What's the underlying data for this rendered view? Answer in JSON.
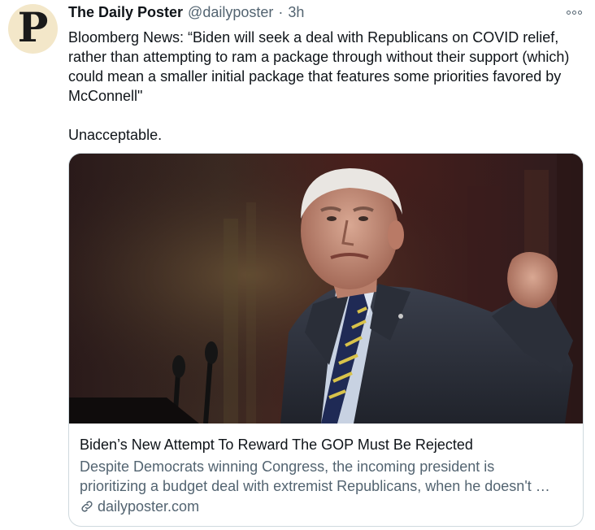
{
  "tweet": {
    "display_name": "The Daily Poster",
    "handle": "@dailyposter",
    "separator": "·",
    "time": "3h",
    "avatar_icon": "gothic-letter-P-logo",
    "avatar_glyph": "P",
    "more_icon": "more-options-icon",
    "text_lines": [
      "Bloomberg News: “Biden will seek a deal with Republicans on COVID relief, rather than attempting to ram a package through without their support (which) could mean a smaller initial package that features some priorities favored by McConnell\"",
      "Unacceptable."
    ]
  },
  "card": {
    "image_description_icon": "link-preview-photo",
    "title": "Biden’s New Attempt To Reward The GOP Must Be Rejected",
    "description_lines": [
      "Despite Democrats winning Congress, the incoming president is",
      "prioritizing a budget deal with extremist Republicans, when he doesn't …"
    ],
    "domain": "dailyposter.com",
    "domain_icon": "link-icon"
  },
  "colors": {
    "text_primary": "#0f1419",
    "text_secondary": "#536471",
    "card_border": "#cfd9de",
    "avatar_bg": "#f3e7c9"
  }
}
